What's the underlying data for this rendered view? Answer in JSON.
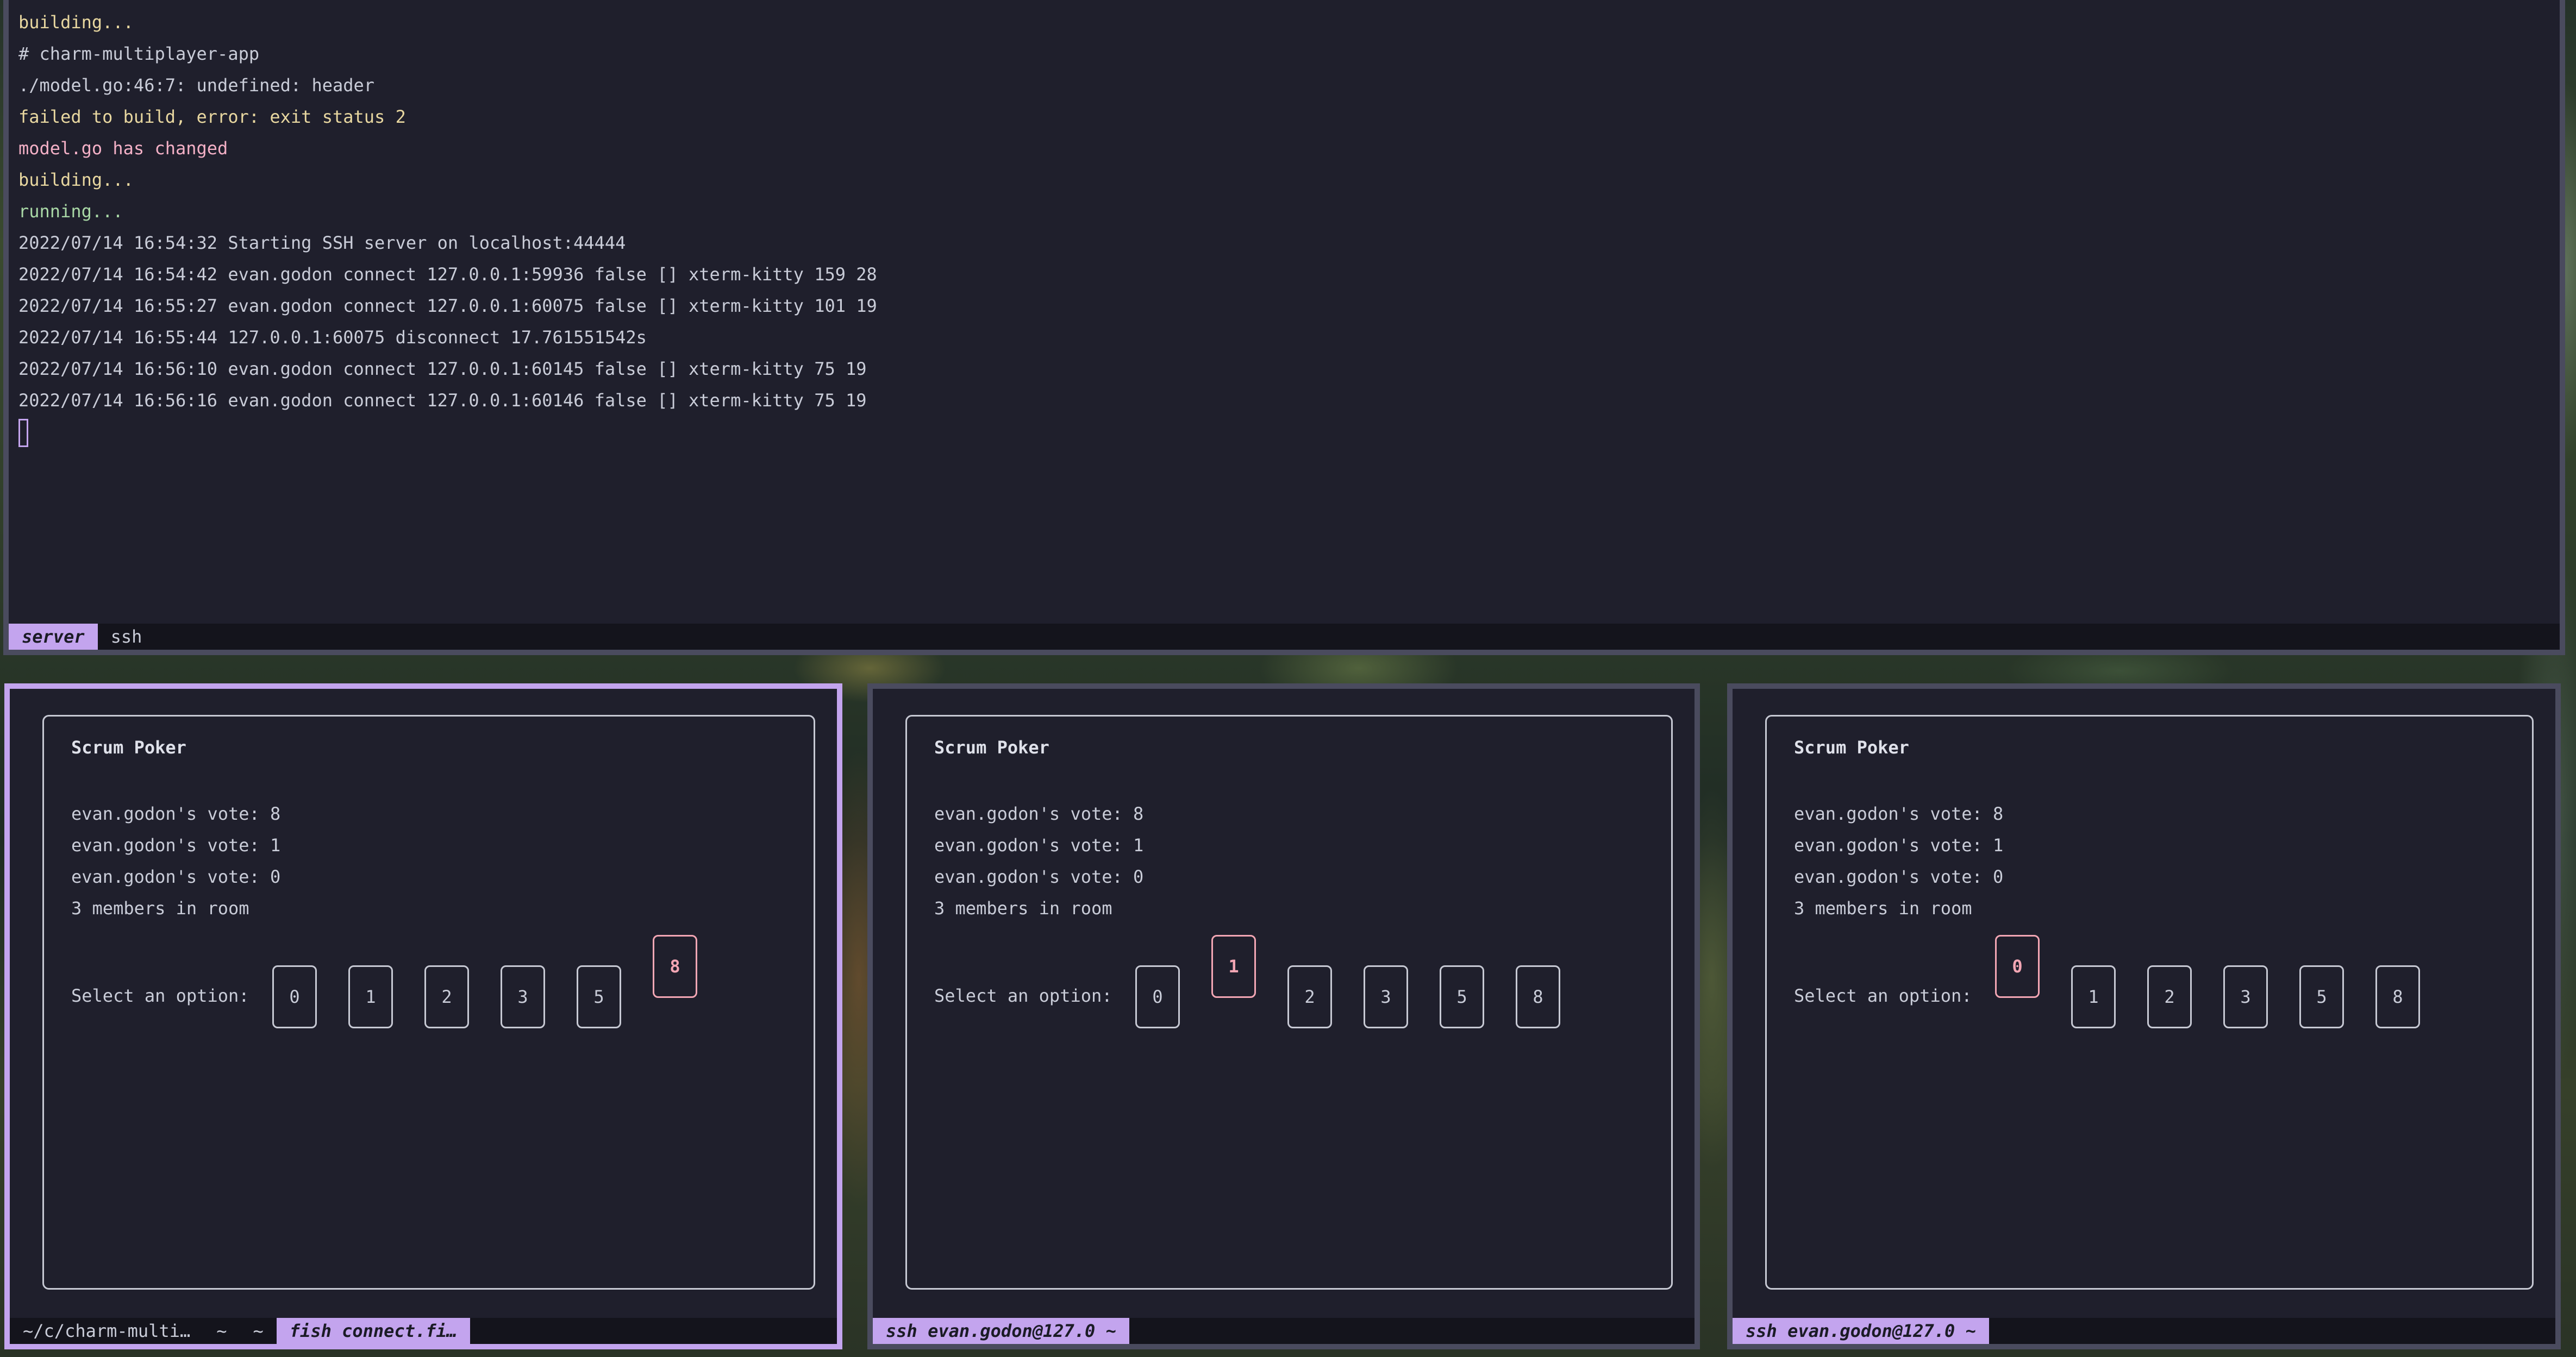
{
  "server_pane": {
    "lines": [
      {
        "text": "building...",
        "color": "#e8d7a0"
      },
      {
        "text": "# charm-multiplayer-app",
        "color": "#c9ccd8"
      },
      {
        "text": "./model.go:46:7: undefined: header",
        "color": "#c9ccd8"
      },
      {
        "text": "failed to build, error: exit status 2",
        "color": "#e8d7a0"
      },
      {
        "text": "model.go has changed",
        "color": "#f3b0c6"
      },
      {
        "text": "building...",
        "color": "#e8d7a0"
      },
      {
        "text": "running...",
        "color": "#a9d8a6"
      },
      {
        "text": "2022/07/14 16:54:32 Starting SSH server on localhost:44444",
        "color": "#c9ccd8"
      },
      {
        "text": "2022/07/14 16:54:42 evan.godon connect 127.0.0.1:59936 false [] xterm-kitty 159 28",
        "color": "#c9ccd8"
      },
      {
        "text": "2022/07/14 16:55:27 evan.godon connect 127.0.0.1:60075 false [] xterm-kitty 101 19",
        "color": "#c9ccd8"
      },
      {
        "text": "2022/07/14 16:55:44 127.0.0.1:60075 disconnect 17.761551542s",
        "color": "#c9ccd8"
      },
      {
        "text": "2022/07/14 16:56:10 evan.godon connect 127.0.0.1:60145 false [] xterm-kitty 75 19",
        "color": "#c9ccd8"
      },
      {
        "text": "2022/07/14 16:56:16 evan.godon connect 127.0.0.1:60146 false [] xterm-kitty 75 19",
        "color": "#c9ccd8"
      }
    ],
    "tabs": [
      "server",
      "ssh"
    ]
  },
  "poker": {
    "title": "Scrum Poker",
    "votes": [
      "evan.godon's vote: 8",
      "evan.godon's vote: 1",
      "evan.godon's vote: 0"
    ],
    "members": "3 members in room",
    "select_label": "Select an option:",
    "options": [
      "0",
      "1",
      "2",
      "3",
      "5",
      "8"
    ]
  },
  "panes": [
    {
      "selected": "8",
      "tabs": [
        "~/c/charm-multi…",
        "~",
        "~",
        "fish connect.fi…"
      ],
      "active_tab": 3
    },
    {
      "selected": "1",
      "tabs": [
        "ssh evan.godon@127.0 ~"
      ],
      "active_tab": 0
    },
    {
      "selected": "0",
      "tabs": [
        "ssh evan.godon@127.0 ~"
      ],
      "active_tab": 0
    }
  ],
  "colors": {
    "accent": "#c3a4ee",
    "selected_card": "#f3a6b4",
    "pane_bg": "#1f1f2c"
  }
}
